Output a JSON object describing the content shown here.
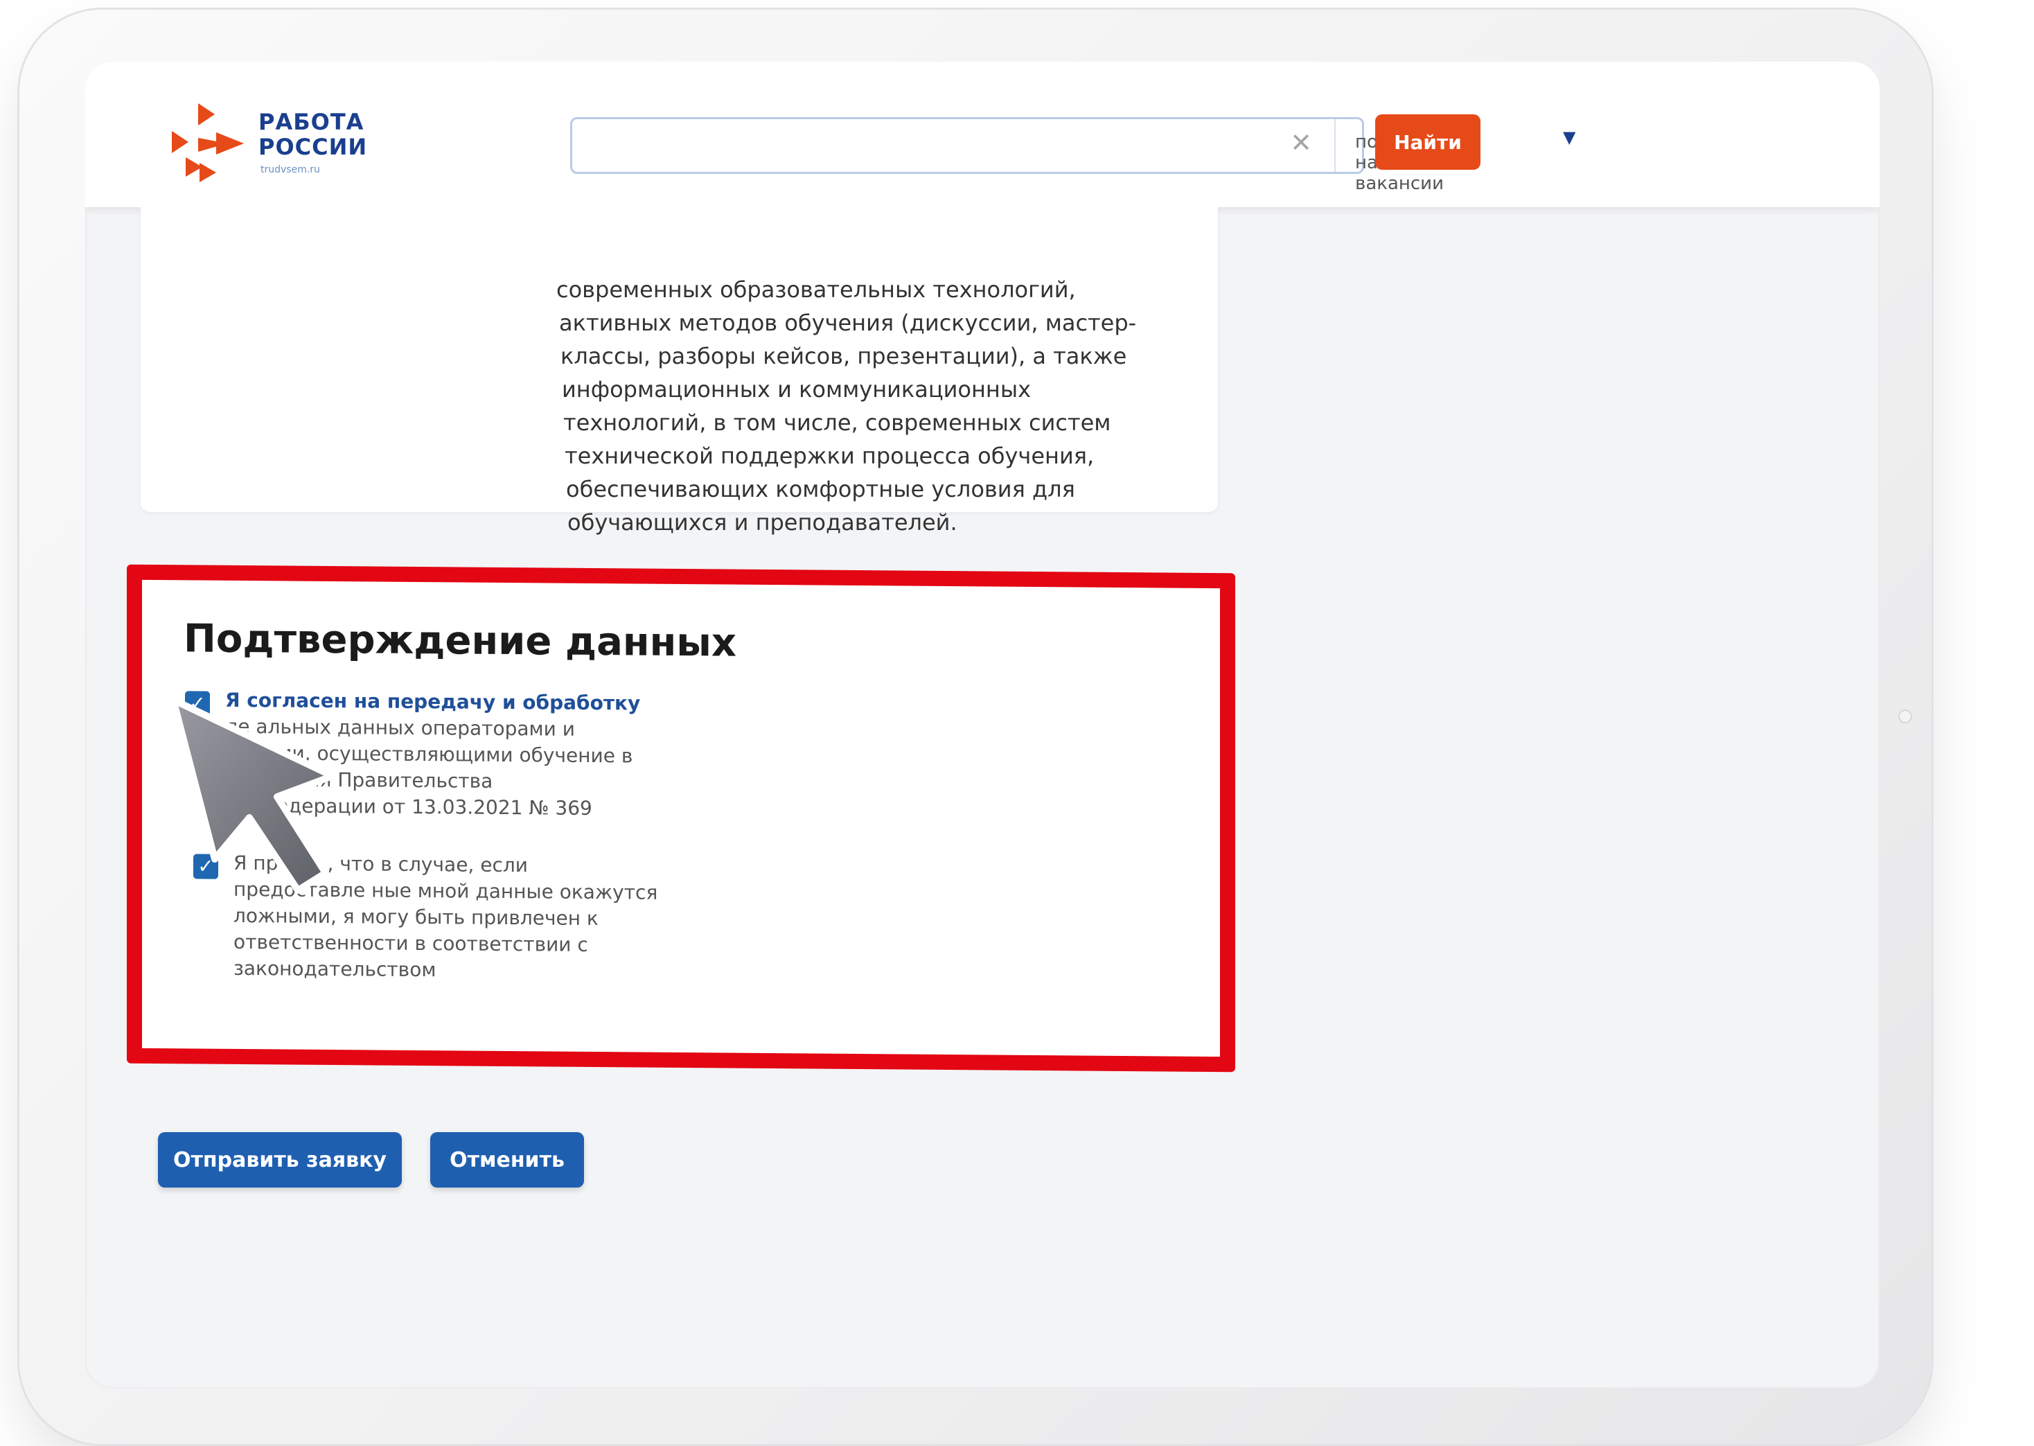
{
  "header": {
    "logo_line1": "РАБОТА",
    "logo_line2": "РОССИИ",
    "logo_sub": "trudvsem.ru",
    "search_placeholder": "",
    "search_clear_icon": "close-icon",
    "search_mode": "по названию вакансии",
    "search_mode_icon": "caret-down-icon",
    "find_label": "Найти",
    "find_color": "#e64a19"
  },
  "description": {
    "lines": [
      "современных образовательных технологий,",
      "активных методов обучения (дискуссии, мастер-",
      "классы, разборы кейсов, презентации), а также",
      "информационных и коммуникационных",
      "технологий, в том числе, современных систем",
      "технической поддержки процесса обучения,",
      "обеспечивающих комфортные условия для",
      "обучающихся и преподавателей."
    ]
  },
  "confirmation": {
    "title": "Подтверждение данных",
    "highlight_color": "#e30613",
    "items": [
      {
        "checked": true,
        "lines": [
          "Я согласен на передачу и обработку",
          "пе           альных данных операторами и",
          "орг           ями, осуществляющими обучение в",
          "рам                 ления Правительства",
          "Росс            едерации от 13.03.2021 № 369"
        ]
      },
      {
        "checked": true,
        "lines": [
          "Я пре      пр       , что в случае, если",
          "предоставле      ные мной данные окажутся",
          "ложными, я могу быть привлечен к",
          "ответственности в соответствии с",
          "законодательством"
        ]
      }
    ]
  },
  "actions": {
    "submit_label": "Отправить заявку",
    "cancel_label": "Отменить",
    "button_color": "#1f5fb0"
  },
  "colors": {
    "brand_blue": "#1a3f8f",
    "brand_red": "#e64a19"
  }
}
